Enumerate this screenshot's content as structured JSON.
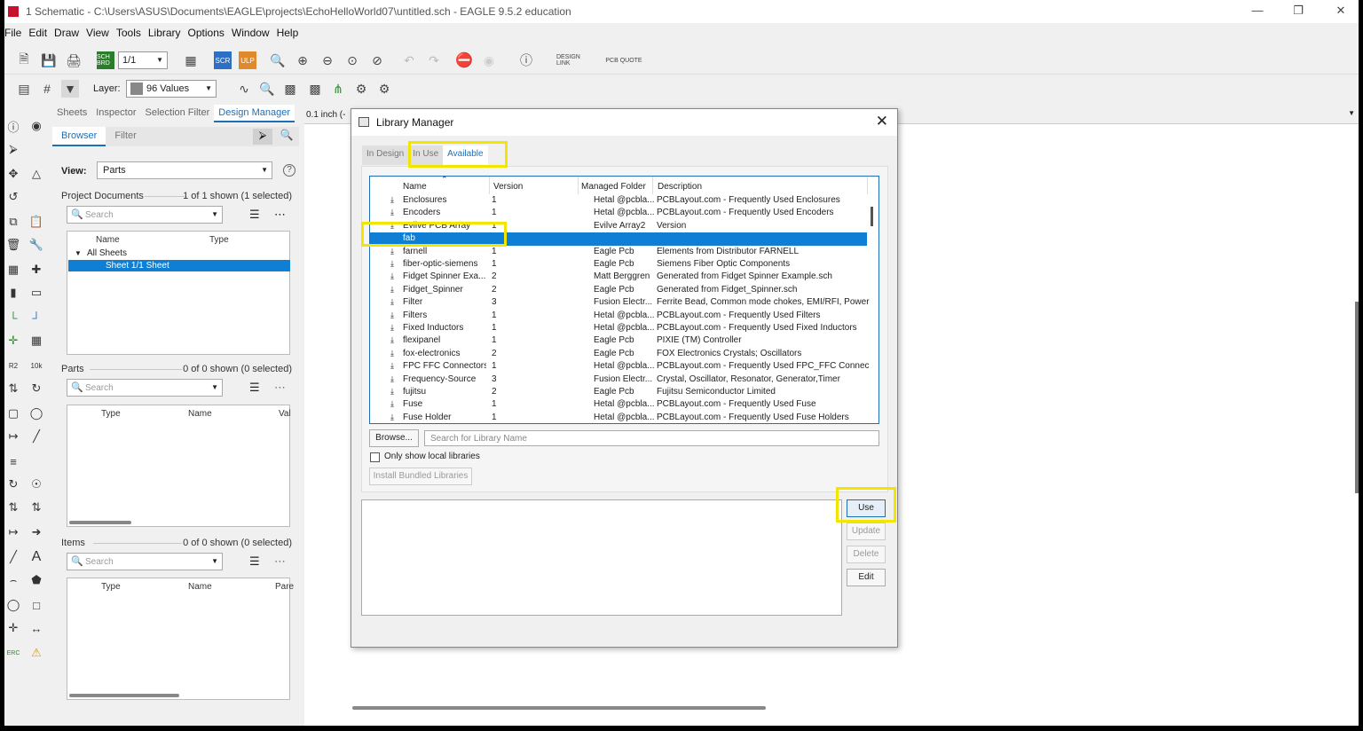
{
  "window": {
    "title": "1 Schematic - C:\\Users\\ASUS\\Documents\\EAGLE\\projects\\EchoHelloWorld07\\untitled.sch - EAGLE 9.5.2 education",
    "minimize": "—",
    "restore": "❐",
    "close": "✕"
  },
  "menu": [
    "File",
    "Edit",
    "Draw",
    "View",
    "Tools",
    "Library",
    "Options",
    "Window",
    "Help"
  ],
  "toolbar": {
    "sheet_value": "1/1",
    "design_link": "DESIGN LINK",
    "pcb_quote": "PCB QUOTE",
    "scr_label": "SCR",
    "ulp_label": "ULP",
    "sch_brd_label": "SCH BRD",
    "layer_label": "Layer:",
    "layer_value": "96 Values",
    "help": "?"
  },
  "panel": {
    "tabs": [
      "Sheets",
      "Inspector",
      "Selection Filter",
      "Design Manager"
    ],
    "subtabs": [
      "Browser",
      "Filter"
    ],
    "view_label": "View:",
    "view_value": "Parts",
    "project_docs": {
      "title": "Project Documents",
      "count": "1 of 1 shown (1 selected)",
      "search": "Search",
      "col_name": "Name",
      "col_type": "Type",
      "tree_root": "All Sheets",
      "tree_item": "Sheet 1/1  Sheet"
    },
    "parts": {
      "title": "Parts",
      "count": "0 of 0 shown (0 selected)",
      "search": "Search",
      "col_type": "Type",
      "col_name": "Name",
      "col_val": "Val"
    },
    "items": {
      "title": "Items",
      "count": "0 of 0 shown (0 selected)",
      "search": "Search",
      "col_type": "Type",
      "col_name": "Name",
      "col_par": "Pare"
    }
  },
  "canvas": {
    "grid_label": "0.1 inch (-"
  },
  "dialog": {
    "title": "Library Manager",
    "close": "✕",
    "tabs": [
      "In Design",
      "In Use",
      "Available"
    ],
    "columns": [
      "Name",
      "Version",
      "Managed Folder",
      "Description"
    ],
    "rows": [
      {
        "name": "Enclosures",
        "version": "1",
        "folder": "Hetal @pcbla...",
        "desc": "PCBLayout.com - Frequently Used Enclosures",
        "selected": false
      },
      {
        "name": "Encoders",
        "version": "1",
        "folder": "Hetal @pcbla...",
        "desc": "PCBLayout.com - Frequently Used Encoders",
        "selected": false
      },
      {
        "name": "Evilve PCB Array",
        "version": "1",
        "folder": "Evilve Array2",
        "desc": "Version",
        "selected": false
      },
      {
        "name": "fab",
        "version": "",
        "folder": "",
        "desc": "",
        "selected": true
      },
      {
        "name": "farnell",
        "version": "1",
        "folder": "Eagle Pcb",
        "desc": "Elements from Distributor FARNELL",
        "selected": false
      },
      {
        "name": "fiber-optic-siemens",
        "version": "1",
        "folder": "Eagle Pcb",
        "desc": "Siemens Fiber Optic Components",
        "selected": false
      },
      {
        "name": "Fidget Spinner Exa...",
        "version": "2",
        "folder": "Matt Berggren",
        "desc": "Generated from Fidget Spinner Example.sch",
        "selected": false
      },
      {
        "name": "Fidget_Spinner",
        "version": "2",
        "folder": "Eagle Pcb",
        "desc": "Generated from Fidget_Spinner.sch",
        "selected": false
      },
      {
        "name": "Filter",
        "version": "3",
        "folder": "Fusion Electr...",
        "desc": "Ferrite Bead, Common mode chokes, EMI/RFI, Power",
        "selected": false
      },
      {
        "name": "Filters",
        "version": "1",
        "folder": "Hetal @pcbla...",
        "desc": "PCBLayout.com - Frequently Used Filters",
        "selected": false
      },
      {
        "name": "Fixed Inductors",
        "version": "1",
        "folder": "Hetal @pcbla...",
        "desc": "PCBLayout.com - Frequently Used Fixed Inductors",
        "selected": false
      },
      {
        "name": "flexipanel",
        "version": "1",
        "folder": "Eagle Pcb",
        "desc": "PIXIE (TM) Controller",
        "selected": false
      },
      {
        "name": "fox-electronics",
        "version": "2",
        "folder": "Eagle Pcb",
        "desc": "FOX Electronics Crystals; Oscillators",
        "selected": false
      },
      {
        "name": "FPC FFC Connectors",
        "version": "1",
        "folder": "Hetal @pcbla...",
        "desc": "PCBLayout.com - Frequently Used FPC_FFC Connec...",
        "selected": false
      },
      {
        "name": "Frequency-Source",
        "version": "3",
        "folder": "Fusion Electr...",
        "desc": "Crystal, Oscillator, Resonator, Generator,Timer",
        "selected": false
      },
      {
        "name": "fujitsu",
        "version": "2",
        "folder": "Eagle Pcb",
        "desc": "Fujitsu Semiconductor Limited",
        "selected": false
      },
      {
        "name": "Fuse",
        "version": "1",
        "folder": "Hetal @pcbla...",
        "desc": "PCBLayout.com - Frequently Used Fuse",
        "selected": false
      },
      {
        "name": "Fuse Holder",
        "version": "1",
        "folder": "Hetal @pcbla...",
        "desc": "PCBLayout.com - Frequently Used Fuse Holders",
        "selected": false
      }
    ],
    "browse": "Browse...",
    "search_placeholder": "Search for Library Name",
    "local_only": "Only show local libraries",
    "install_bundled": "Install Bundled Libraries",
    "use": "Use",
    "update": "Update",
    "delete": "Delete",
    "edit": "Edit"
  },
  "colors": {
    "accent": "#1e6fb7",
    "selection": "#0e7fd4",
    "highlight": "#f2e600"
  }
}
